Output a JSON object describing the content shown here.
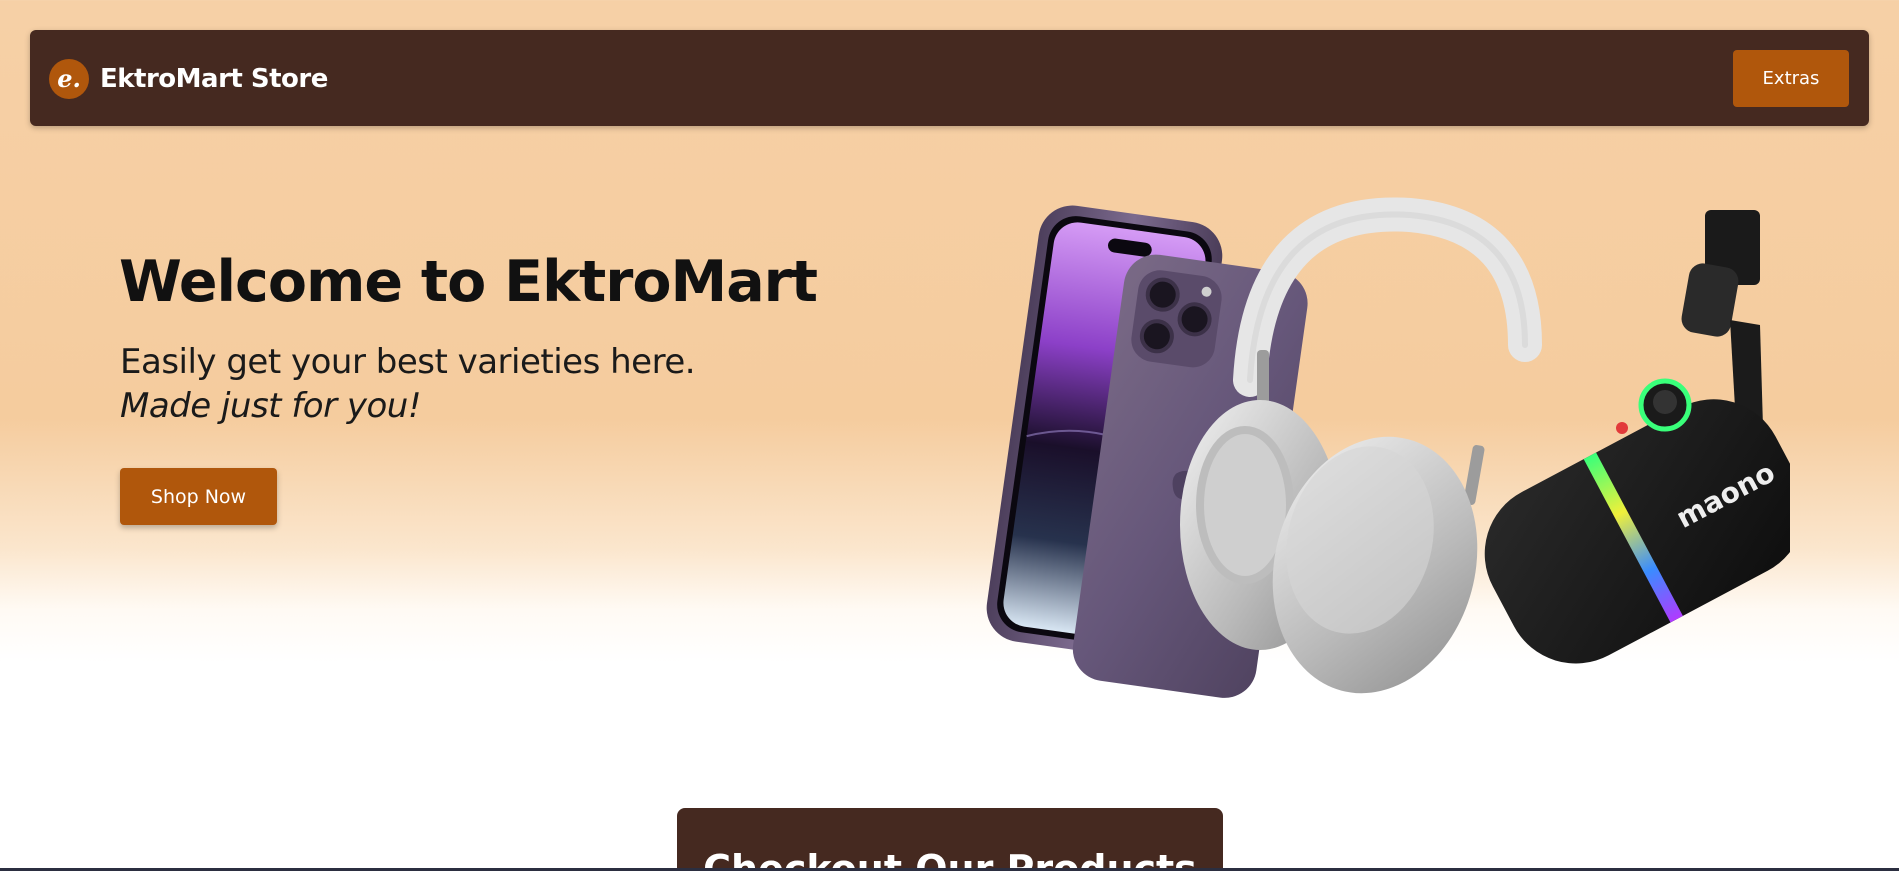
{
  "header": {
    "logo_letter": "e.",
    "brand_name": "EktroMart Store",
    "extras_label": "Extras"
  },
  "hero": {
    "title": "Welcome to EktroMart",
    "subtitle": "Easily get your best varieties here.",
    "tagline": "Made just for you!",
    "shop_button_label": "Shop Now",
    "image_alt": "iPhone, headphones and microphone"
  },
  "products_section": {
    "title": "Checkout Our Products"
  },
  "colors": {
    "header_bg": "#452920",
    "accent": "#b0570c",
    "hero_bg": "#f5cc9e",
    "text_dark": "#111111"
  }
}
